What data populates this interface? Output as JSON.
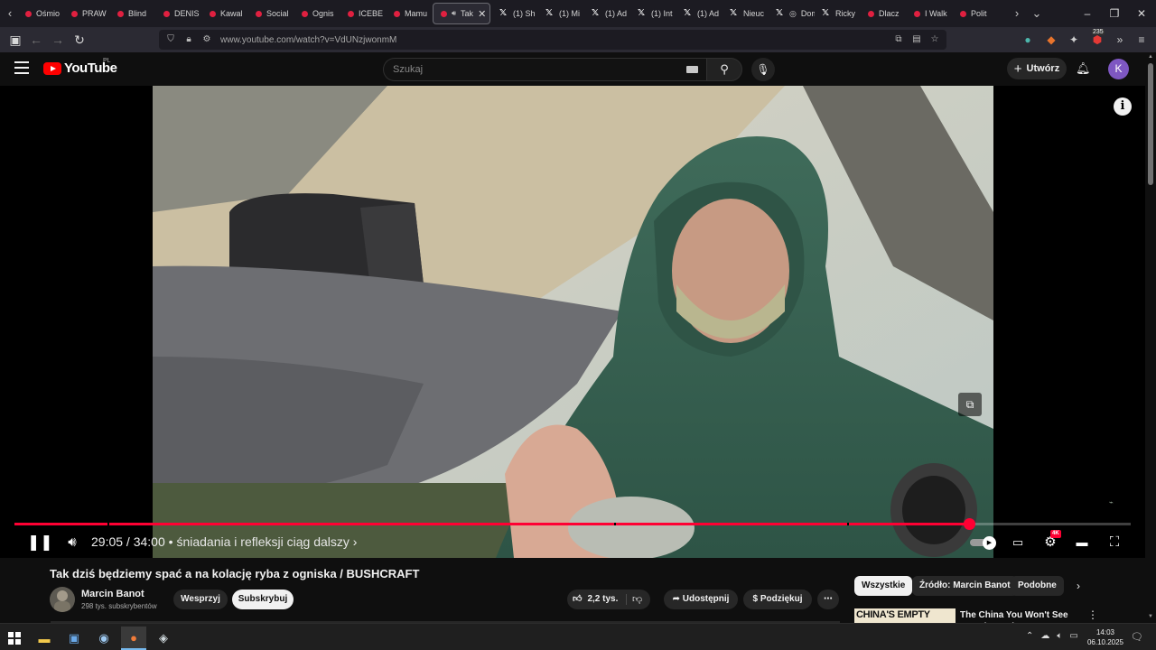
{
  "browser": {
    "tabs": [
      {
        "label": "Ośmio",
        "kind": "yt"
      },
      {
        "label": "PRAW",
        "kind": "yt"
      },
      {
        "label": "Blind",
        "kind": "yt"
      },
      {
        "label": "DENIS",
        "kind": "yt"
      },
      {
        "label": "Kawal",
        "kind": "yt"
      },
      {
        "label": "Social",
        "kind": "yt"
      },
      {
        "label": "Ognis",
        "kind": "yt"
      },
      {
        "label": "ICEBE",
        "kind": "yt"
      },
      {
        "label": "Mamu",
        "kind": "yt"
      },
      {
        "label": "Tak",
        "kind": "yt-active"
      },
      {
        "label": "(1) Sh",
        "kind": "x"
      },
      {
        "label": "(1) Mi",
        "kind": "x"
      },
      {
        "label": "(1) Ad",
        "kind": "x"
      },
      {
        "label": "(1) Int",
        "kind": "x"
      },
      {
        "label": "(1) Ad",
        "kind": "x"
      },
      {
        "label": "Nieuc",
        "kind": "x"
      },
      {
        "label": "Dom I",
        "kind": "x-circle"
      },
      {
        "label": "Ricky",
        "kind": "x"
      },
      {
        "label": "Dlacz",
        "kind": "yt"
      },
      {
        "label": "I Walk",
        "kind": "yt"
      },
      {
        "label": "Polit",
        "kind": "yt"
      }
    ],
    "url": "www.youtube.com/watch?v=VdUNzjwonmM",
    "extension_badge": "235"
  },
  "youtube": {
    "logo_text": "YouTube",
    "logo_region": "PL",
    "search_placeholder": "Szukaj",
    "create_label": "Utwórz",
    "avatar_letter": "K",
    "brand_color": "#ff0000",
    "accent_color": "#ff0033"
  },
  "player": {
    "current_time": "29:05",
    "duration": "34:00",
    "time_separator": " / ",
    "chapter": "śniadania i refleksji ciąg dalszy",
    "played_fraction": 0.855,
    "buffered_fraction": 0.86,
    "quality_badge": "4K",
    "autoplay_on": true
  },
  "video": {
    "title": "Tak dziś będziemy spać a na kolację ryba z ogniska / BUSHCRAFT",
    "channel_name": "Marcin Banot",
    "subscribers": "298 tys. subskrybentów",
    "support_label": "Wesprzyj",
    "subscribe_label": "Subskrybuj",
    "likes": "2,2 tys.",
    "share_label": "Udostępnij",
    "thanks_label": "Podziękuj",
    "more_label": "⋯"
  },
  "related": {
    "chips": [
      "Wszystkie",
      "Źródło: Marcin Banot",
      "Podobne"
    ],
    "selected_chip": "Wszystkie",
    "first_item": {
      "thumb_text": "CHINA'S EMPTY LANDS",
      "title": "The China You Won't See Anywhere Else"
    }
  },
  "taskbar": {
    "time": "14:03",
    "date": "06.10.2025"
  }
}
